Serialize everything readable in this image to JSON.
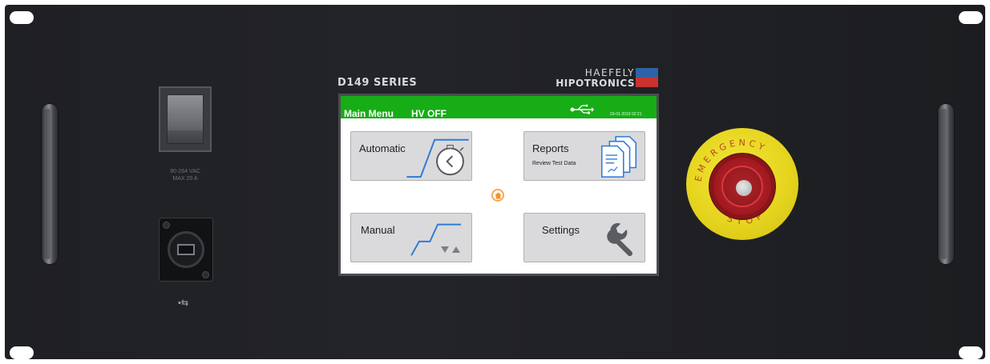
{
  "front_panel": {
    "series": "D149 SERIES",
    "brand_top": "HAEFELY",
    "brand_bottom": "HIPOTRONICS",
    "power_label_line1": "90-264 VAC",
    "power_label_line2": "MAX 20 A",
    "usb_symbol": "•⇆"
  },
  "screen": {
    "title": "Main Menu",
    "hv_status": "HV OFF",
    "datetime": "03-01-2019 02:21",
    "colors": {
      "titlebar": "#17ad17",
      "accent_blue": "#2e7bd6",
      "home": "#f7931e"
    }
  },
  "menu": {
    "automatic": {
      "label": "Automatic"
    },
    "reports": {
      "label": "Reports",
      "sublabel": "Review Test Data"
    },
    "manual": {
      "label": "Manual"
    },
    "settings": {
      "label": "Settings"
    }
  },
  "estop": {
    "top_text": "EMERGENCY",
    "bottom_text": "STOP"
  },
  "icons": [
    "usb-icon",
    "home-icon",
    "stopwatch-icon",
    "documents-icon",
    "wrench-icon",
    "arrow-up-icon",
    "arrow-down-icon"
  ]
}
